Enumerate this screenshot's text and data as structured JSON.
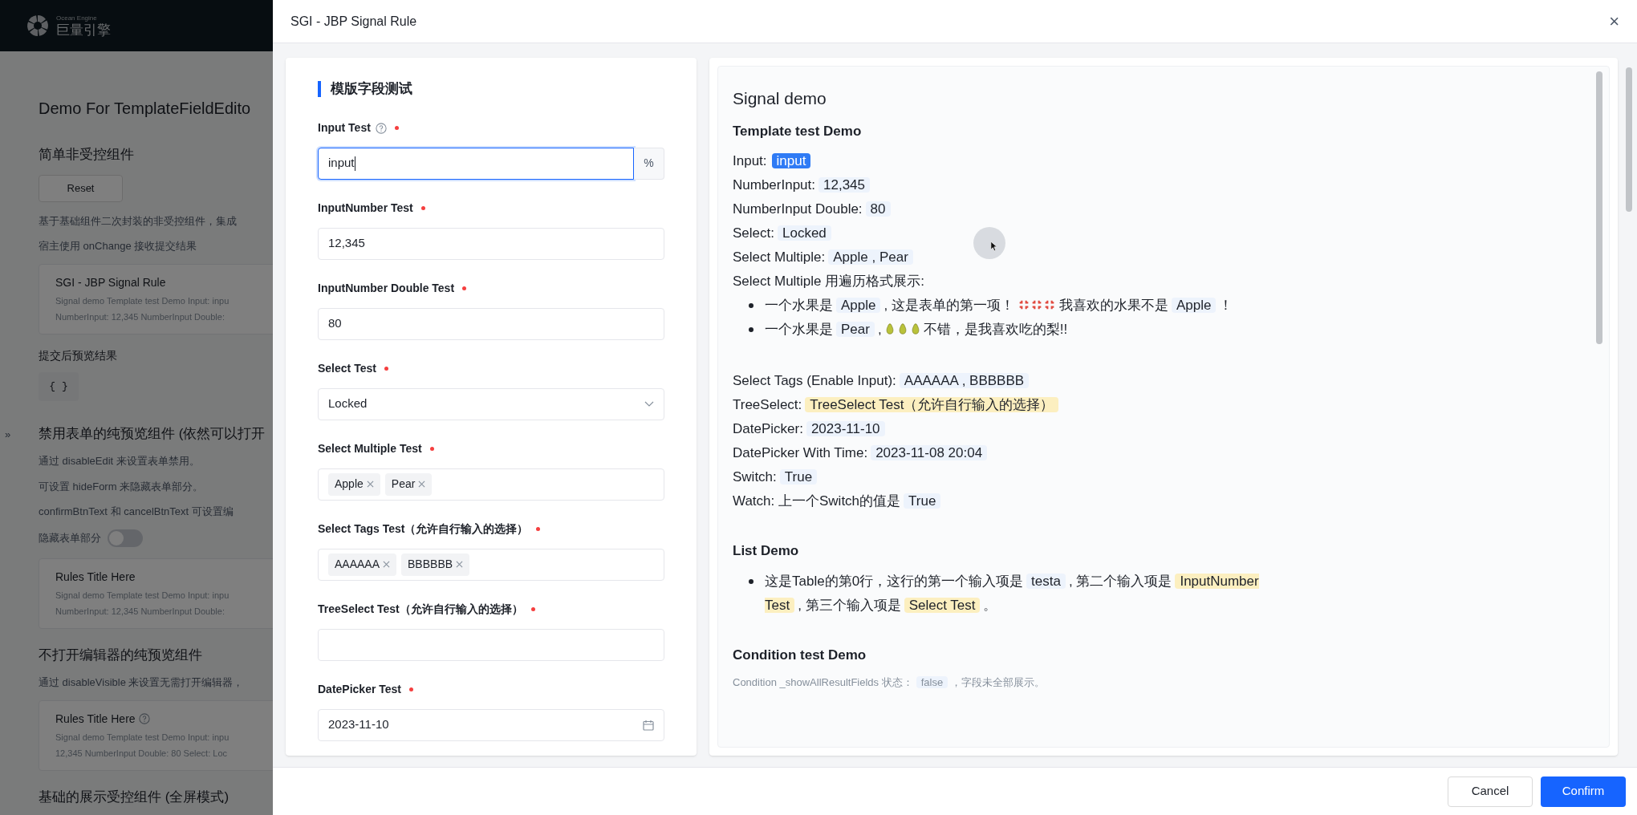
{
  "page": {
    "logo": {
      "small": "Ocean Engine",
      "name": "巨量引擎"
    },
    "title": "Demo For TemplateFieldEdito",
    "blocks": [
      {
        "kind": "heading",
        "text": "简单非受控组件"
      },
      {
        "kind": "button",
        "text": "Reset"
      },
      {
        "kind": "para",
        "text": "基于基础组件二次封装的非受控组件，集成"
      },
      {
        "kind": "para",
        "text": "宿主使用 onChange 接收提交结果"
      },
      {
        "kind": "card",
        "title": "SGI - JBP Signal Rule",
        "lines": [
          "Signal demo Template test Demo Input: inpu",
          "NumberInput: 12,345 NumberInput Double:"
        ]
      },
      {
        "kind": "subheading",
        "text": "提交后预览结果"
      },
      {
        "kind": "code",
        "text": "{ }"
      },
      {
        "kind": "heading",
        "text": "禁用表单的纯预览组件 (依然可以打开"
      },
      {
        "kind": "para",
        "text": "通过 disableEdit 来设置表单禁用。"
      },
      {
        "kind": "para",
        "text": "可设置 hideForm 来隐藏表单部分。"
      },
      {
        "kind": "para",
        "text": "confirmBtnText 和 cancelBtnText 可设置编"
      },
      {
        "kind": "switch",
        "text": "隐藏表单部分",
        "on": false
      },
      {
        "kind": "card",
        "title": "Rules Title Here",
        "lines": [
          "Signal demo Template test Demo Input: inpu",
          "NumberInput: 12,345 NumberInput Double:"
        ]
      },
      {
        "kind": "heading",
        "text": "不打开编辑器的纯预览组件"
      },
      {
        "kind": "para",
        "text": "通过 disableVisible 来设置无需打开编辑器，"
      },
      {
        "kind": "card",
        "title": "Rules Title Here",
        "help": true,
        "lines": [
          "Signal demo Template test Demo Input: inpu",
          "12,345 NumberInput Double: 80 Select: Loc"
        ]
      },
      {
        "kind": "heading",
        "text": "基础的展示受控组件 (全屏模式)"
      }
    ],
    "expand": "»"
  },
  "drawer": {
    "title": "SGI - JBP Signal Rule",
    "close": "×",
    "form": {
      "heading": "模版字段测试",
      "fields": [
        {
          "label": "Input Test",
          "help": true,
          "required": true,
          "kind": "input",
          "value": "input",
          "suffix": "%",
          "focused": true
        },
        {
          "label": "InputNumber Test",
          "required": true,
          "kind": "input",
          "value": "12,345",
          "focused": false
        },
        {
          "label": "InputNumber Double Test",
          "required": true,
          "kind": "input",
          "value": "80",
          "focused": false
        },
        {
          "label": "Select Test",
          "required": true,
          "kind": "select",
          "value": "Locked",
          "focused": false
        },
        {
          "label": "Select Multiple Test",
          "required": true,
          "kind": "tags",
          "tags": [
            "Apple",
            "Pear"
          ],
          "focused": false
        },
        {
          "label": "Select Tags Test（允许自行输入的选择）",
          "required": true,
          "kind": "tags",
          "tags": [
            "AAAAAA",
            "BBBBBB"
          ],
          "focused": false
        },
        {
          "label": "TreeSelect Test（允许自行输入的选择）",
          "required": true,
          "kind": "input",
          "focused": false
        },
        {
          "label": "DatePicker Test",
          "required": true,
          "kind": "date",
          "value": "2023-11-10",
          "focused": false
        }
      ]
    },
    "preview": {
      "title": "Signal demo",
      "sections": [
        {
          "heading": "Template test Demo",
          "lines": [
            {
              "kind": "line",
              "segments": [
                {
                  "kind": "text",
                  "text": "Input:"
                },
                {
                  "kind": "focus",
                  "text": "input"
                }
              ]
            },
            {
              "kind": "line",
              "segments": [
                {
                  "kind": "text",
                  "text": "NumberInput:"
                },
                {
                  "kind": "value",
                  "text": "12,345"
                }
              ]
            },
            {
              "kind": "line",
              "segments": [
                {
                  "kind": "text",
                  "text": "NumberInput Double:"
                },
                {
                  "kind": "value",
                  "text": "80"
                }
              ]
            },
            {
              "kind": "line",
              "segments": [
                {
                  "kind": "text",
                  "text": "Select:"
                },
                {
                  "kind": "value",
                  "text": "Locked"
                }
              ]
            },
            {
              "kind": "line",
              "segments": [
                {
                  "kind": "text",
                  "text": "Select Multiple:"
                },
                {
                  "kind": "value",
                  "text": "Apple , Pear"
                }
              ]
            },
            {
              "kind": "line",
              "segments": [
                {
                  "kind": "text",
                  "text": "Select Multiple 用遍历格式展示:"
                }
              ]
            },
            {
              "kind": "bullets",
              "items": [
                {
                  "segments": [
                    {
                      "kind": "text",
                      "text": "一个水果是"
                    },
                    {
                      "kind": "value",
                      "text": "Apple"
                    },
                    {
                      "kind": "text",
                      "text": ", 这是表单的第一项！"
                    },
                    {
                      "kind": "anger"
                    },
                    {
                      "kind": "text",
                      "text": "我喜欢的水果不是"
                    },
                    {
                      "kind": "value",
                      "text": "Apple"
                    },
                    {
                      "kind": "text",
                      "text": "！"
                    }
                  ]
                },
                {
                  "segments": [
                    {
                      "kind": "text",
                      "text": "一个水果是"
                    },
                    {
                      "kind": "value",
                      "text": "Pear"
                    },
                    {
                      "kind": "text",
                      "text": ","
                    },
                    {
                      "kind": "pear"
                    },
                    {
                      "kind": "text",
                      "text": "不错，是我喜欢吃的梨!!"
                    }
                  ]
                }
              ]
            }
          ]
        },
        {
          "lines": [
            {
              "kind": "line",
              "segments": [
                {
                  "kind": "text",
                  "text": "Select Tags (Enable Input):"
                },
                {
                  "kind": "value",
                  "text": "AAAAAA , BBBBBB"
                }
              ]
            },
            {
              "kind": "line",
              "segments": [
                {
                  "kind": "text",
                  "text": "TreeSelect:"
                },
                {
                  "kind": "highlight",
                  "text": "TreeSelect Test（允许自行输入的选择）"
                }
              ]
            },
            {
              "kind": "line",
              "segments": [
                {
                  "kind": "text",
                  "text": "DatePicker:"
                },
                {
                  "kind": "value",
                  "text": "2023-11-10"
                }
              ]
            },
            {
              "kind": "line",
              "segments": [
                {
                  "kind": "text",
                  "text": "DatePicker With Time:"
                },
                {
                  "kind": "value",
                  "text": "2023-11-08 20:04"
                }
              ]
            },
            {
              "kind": "line",
              "segments": [
                {
                  "kind": "text",
                  "text": "Switch:"
                },
                {
                  "kind": "value",
                  "text": "True"
                }
              ]
            },
            {
              "kind": "line",
              "segments": [
                {
                  "kind": "text",
                  "text": "Watch: 上一个Switch的值是"
                },
                {
                  "kind": "value",
                  "text": "True"
                }
              ]
            }
          ]
        },
        {
          "heading": "List Demo",
          "lines": [
            {
              "kind": "bullets",
              "items": [
                {
                  "segments": [
                    {
                      "kind": "text",
                      "text": "这是Table的第0行，这行的第一个输入项是"
                    },
                    {
                      "kind": "value",
                      "text": "testa"
                    },
                    {
                      "kind": "text",
                      "text": ", 第二个输入项是"
                    },
                    {
                      "kind": "highlight",
                      "text": "InputNumber Test"
                    },
                    {
                      "kind": "text",
                      "text": ", 第三个输入项是"
                    },
                    {
                      "kind": "highlight",
                      "text": "Select Test"
                    },
                    {
                      "kind": "text",
                      "text": "。"
                    }
                  ]
                }
              ]
            }
          ]
        },
        {
          "heading": "Condition test Demo",
          "lines": [
            {
              "kind": "note",
              "segments": [
                {
                  "kind": "text",
                  "text": "Condition _showAllResultFields 状态："
                },
                {
                  "kind": "value",
                  "text": "false"
                },
                {
                  "kind": "text",
                  "text": "，字段未全部展示。"
                }
              ]
            }
          ]
        }
      ]
    },
    "buttons": [
      {
        "text": "Cancel",
        "primary": false
      },
      {
        "text": "Confirm",
        "primary": true
      }
    ]
  }
}
